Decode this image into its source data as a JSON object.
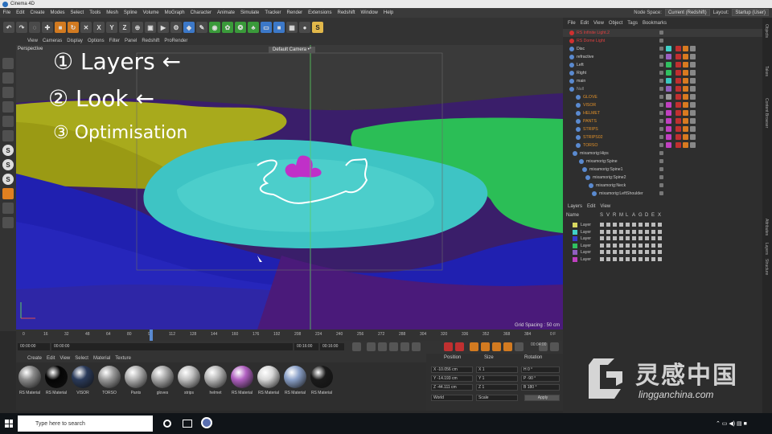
{
  "window": {
    "title": "Cinema 4D"
  },
  "menu": [
    "File",
    "Edit",
    "Create",
    "Modes",
    "Select",
    "Tools",
    "Mesh",
    "Spline",
    "Volume",
    "MoGraph",
    "Character",
    "Animate",
    "Simulate",
    "Tracker",
    "Render",
    "Extensions",
    "Redshift",
    "Window",
    "Help"
  ],
  "node_space": {
    "label": "Node Space:",
    "value": "Current (Redshift)"
  },
  "layout": {
    "label": "Layout:",
    "value": "Startup (User)"
  },
  "viewport_menu": [
    "View",
    "Cameras",
    "Display",
    "Options",
    "Filter",
    "Panel",
    "Redshift",
    "ProRender"
  ],
  "viewport": {
    "name": "Perspective",
    "camera": "Default Camera •°",
    "grid_spacing": "Grid Spacing : 50 cm"
  },
  "annotations": [
    "① Layers ←",
    "② Look ←",
    "③ Optimisation"
  ],
  "timeline": {
    "ticks": [
      "0",
      "16",
      "32",
      "48",
      "64",
      "80",
      "96",
      "112",
      "128",
      "144",
      "160",
      "176",
      "192",
      "208",
      "224",
      "240",
      "256",
      "272",
      "288",
      "304",
      "320",
      "336",
      "352",
      "368",
      "384"
    ],
    "end_frame": "0 F"
  },
  "transport": {
    "current": "00:00:00",
    "start": "00:00:00",
    "end1": "00:16:00",
    "end2": "00:16:00",
    "time_right": "00:04:00"
  },
  "material_menu": [
    "Create",
    "Edit",
    "View",
    "Select",
    "Material",
    "Texture"
  ],
  "materials": [
    {
      "name": "RS Material",
      "color": "#8a8a8a"
    },
    {
      "name": "RS Material",
      "color": "#050505"
    },
    {
      "name": "VISOR",
      "color": "#2a3a5a"
    },
    {
      "name": "TORSO",
      "color": "#9a9a9a"
    },
    {
      "name": "Pants",
      "color": "#b0b0b0"
    },
    {
      "name": "gloves",
      "color": "#a8a8a8"
    },
    {
      "name": "strips",
      "color": "#c0c0c0"
    },
    {
      "name": "helmet",
      "color": "#b8b8b8"
    },
    {
      "name": "RS Material",
      "color": "#b060c0"
    },
    {
      "name": "RS Material",
      "color": "#d8d8d8"
    },
    {
      "name": "RS Material",
      "color": "#8aa0c8"
    },
    {
      "name": "RS Material",
      "color": "#1a1a1a"
    }
  ],
  "attributes": {
    "headers": [
      "Position",
      "Size",
      "Rotation"
    ],
    "position": [
      "X -10.056 cm",
      "Y -14.193 cm",
      "Z -44.111 cm"
    ],
    "size": [
      "X 1",
      "Y 1",
      "Z 1"
    ],
    "rotation": [
      "H 0 °",
      "P -90 °",
      "B 180 °"
    ],
    "mode1": "World",
    "mode2": "Scale",
    "apply": "Apply"
  },
  "object_menu": [
    "File",
    "Edit",
    "View",
    "Object",
    "Tags",
    "Bookmarks"
  ],
  "objects": [
    {
      "name": "RS Infinite Light.2",
      "color": "#e04040"
    },
    {
      "name": "RS Dome Light",
      "color": "#e04040"
    },
    {
      "name": "Disc",
      "color": "#d0d0d0"
    },
    {
      "name": "refractive",
      "color": "#d0d0d0"
    },
    {
      "name": "Left",
      "color": "#d0d0d0"
    },
    {
      "name": "Right",
      "color": "#d0d0d0"
    },
    {
      "name": "main",
      "color": "#d0d0d0"
    },
    {
      "name": "Null",
      "color": "#9a9a9a"
    },
    {
      "name": "GLOVE",
      "color": "#e0902a"
    },
    {
      "name": "VISOR",
      "color": "#e0902a"
    },
    {
      "name": "HELMET",
      "color": "#e0902a"
    },
    {
      "name": "PANTS",
      "color": "#e0902a"
    },
    {
      "name": "STRIPS",
      "color": "#e0902a"
    },
    {
      "name": "STRIPS02",
      "color": "#e0902a"
    },
    {
      "name": "TORSO",
      "color": "#e0902a"
    },
    {
      "name": "mixamorig:Hips",
      "color": "#c8c8c8"
    },
    {
      "name": "mixamorig:Spine",
      "color": "#c8c8c8"
    },
    {
      "name": "mixamorig:Spine1",
      "color": "#c8c8c8"
    },
    {
      "name": "mixamorig:Spine2",
      "color": "#c8c8c8"
    },
    {
      "name": "mixamorig:Neck",
      "color": "#c8c8c8"
    },
    {
      "name": "mixamorig:LeftShoulder",
      "color": "#c8c8c8"
    }
  ],
  "layer_menu": [
    "Layers",
    "Edit",
    "View"
  ],
  "layer_columns": [
    "Name",
    "S",
    "V",
    "R",
    "M",
    "L",
    "A",
    "G",
    "D",
    "E",
    "X"
  ],
  "layers": [
    {
      "name": "Layer",
      "color": "#d8d860"
    },
    {
      "name": "Layer",
      "color": "#40d0c8"
    },
    {
      "name": "Layer",
      "color": "#3a3acb"
    },
    {
      "name": "Layer",
      "color": "#30c060"
    },
    {
      "name": "Layer",
      "color": "#9060c0"
    },
    {
      "name": "Layer",
      "color": "#c040c0"
    }
  ],
  "side_tabs": [
    "Objects",
    "Takes",
    "Content Browser",
    "Attributes",
    "Layers",
    "Structure"
  ],
  "watermark": {
    "name": "灵感中国",
    "url": "lingganchina.com"
  },
  "taskbar": {
    "search": "Type here to search"
  }
}
